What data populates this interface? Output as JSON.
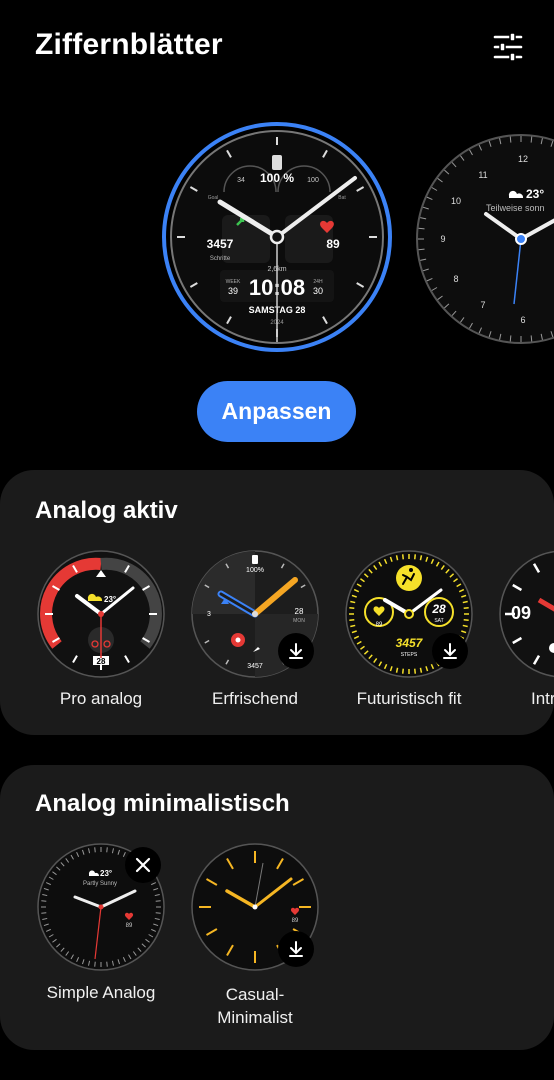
{
  "header": {
    "title": "Ziffernblätter"
  },
  "current_face": {
    "steps_label": "Schritte",
    "steps": "3457",
    "heart": "89",
    "battery_pct": "100 %",
    "goal_label": "Goal",
    "goal": "34",
    "bat_label": "Bat",
    "bat": "100",
    "distance": "2,6km",
    "week_label": "WEEK",
    "week": "39",
    "time": "10:08",
    "h24_label": "24H",
    "h24": "30",
    "date": "SAMSTAG 28",
    "year": "2024"
  },
  "next_face": {
    "temp": "23°",
    "condition": "Teilweise sonn",
    "n12": "12",
    "n11": "11",
    "n10": "10",
    "n9": "9",
    "n8": "8",
    "n7": "7",
    "n6": "6"
  },
  "customize_label": "Anpassen",
  "sections": [
    {
      "title": "Analog aktiv",
      "items": [
        {
          "label": "Pro analog",
          "temp": "23°",
          "day": "28"
        },
        {
          "label": "Erfrischend",
          "battery": "100%",
          "steps": "3457",
          "date": "28",
          "day": "MON",
          "level": "3"
        },
        {
          "label": "Futuristisch fit",
          "heart": "89",
          "date": "28",
          "day": "SAT",
          "steps": "3457",
          "steps_label": "STEPS"
        },
        {
          "label": "Intr",
          "hour": "09"
        }
      ]
    },
    {
      "title": "Analog minimalistisch",
      "items": [
        {
          "label": "Simple Analog",
          "temp": "23°",
          "condition": "Partly Sunny",
          "heart": "89"
        },
        {
          "label": "Casual-Minimalist",
          "heart": "89"
        }
      ]
    }
  ],
  "colors": {
    "accent": "#3b82f6",
    "card": "#1b1b1b",
    "yellow": "#f5e02a",
    "red": "#e53935"
  }
}
